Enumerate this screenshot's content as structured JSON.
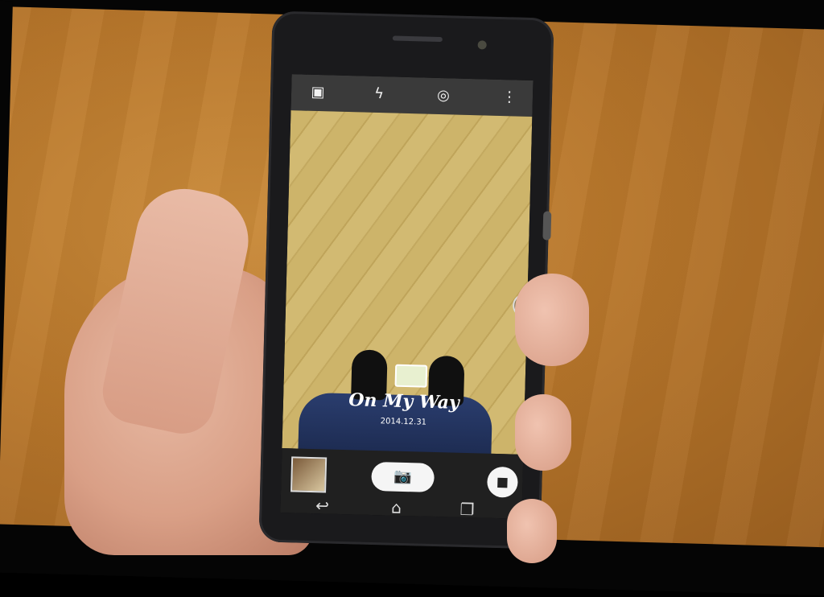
{
  "camera_app": {
    "watermark": {
      "title": "On My Way",
      "date": "2014.12.31"
    }
  }
}
